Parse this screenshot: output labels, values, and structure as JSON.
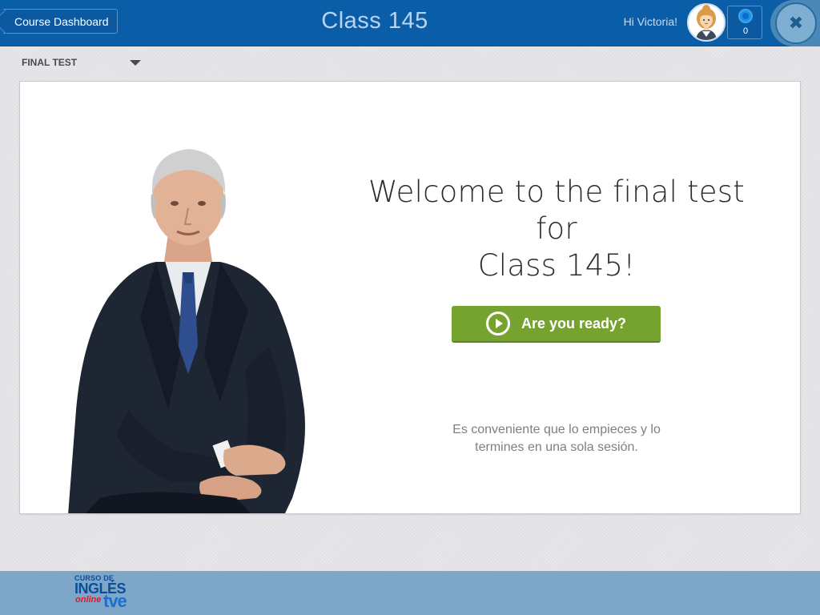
{
  "header": {
    "back_label": "Course Dashboard",
    "title": "Class 145",
    "greeting": "Hi Victoria!",
    "points": "0",
    "close_symbol": "✖"
  },
  "section_select": {
    "selected": "FINAL TEST"
  },
  "main": {
    "welcome_line1": "Welcome to the final test for",
    "welcome_line2": "Class 145!",
    "ready_label": "Are you ready?",
    "note_line1": "Es conveniente que lo empieces y lo",
    "note_line2": "termines en una sola sesión."
  },
  "footer": {
    "logo": {
      "line1": "CURSO DE",
      "line2": "INGLÉS",
      "line3": "online",
      "line4": "tve"
    }
  },
  "colors": {
    "header_bg": "#0a5ea8",
    "accent_green": "#76a330",
    "footer_bg": "#7ea6c9",
    "page_bg": "#e4e4e8"
  },
  "icons": {
    "back": "chevron-left-icon",
    "close": "close-icon",
    "medal": "medal-icon",
    "play": "play-icon",
    "dropdown": "caret-down-icon"
  }
}
